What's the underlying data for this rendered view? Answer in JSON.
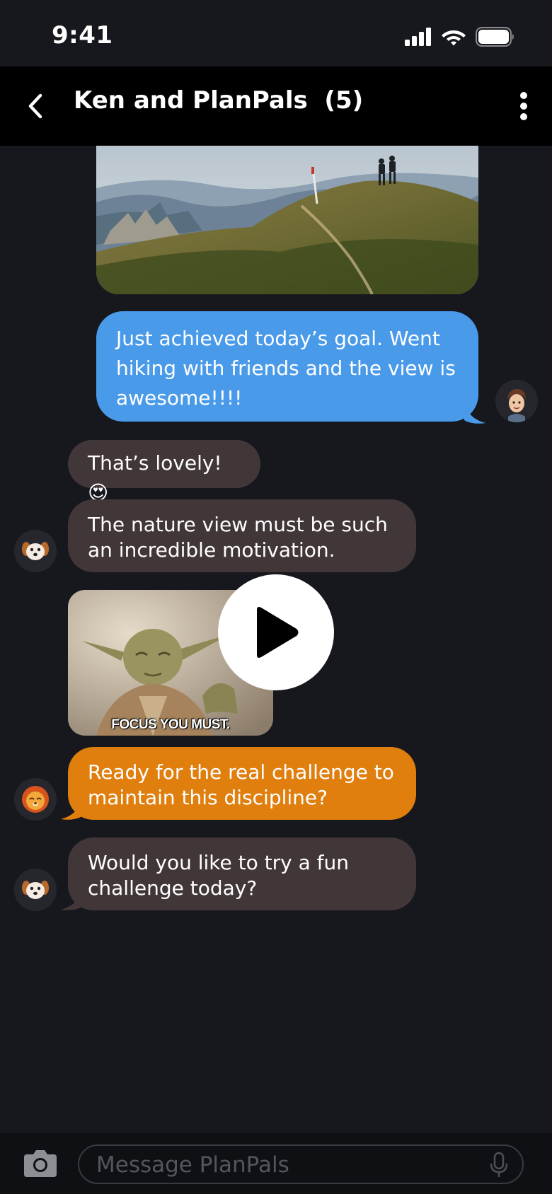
{
  "status_bar": {
    "time": "9:41",
    "icons": [
      "signal-icon",
      "wifi-icon",
      "battery-icon"
    ]
  },
  "header": {
    "back_icon": "chevron-left-icon",
    "title": "Ken and PlanPals  (5)",
    "more_icon": "more-vertical-icon"
  },
  "messages": [
    {
      "type": "image",
      "sender": "me",
      "description_icon": "photo"
    },
    {
      "type": "text",
      "sender": "me",
      "text": "Just achieved today’s goal. Went hiking with friends and the view is awesome!!!!"
    },
    {
      "type": "text",
      "sender": "puppy",
      "text": "That’s lovely! 😍"
    },
    {
      "type": "text",
      "sender": "puppy",
      "text": "The nature view must be such an incredible motivation."
    },
    {
      "type": "video",
      "sender": "puppy",
      "caption": "FOCUS YOU MUST."
    },
    {
      "type": "text",
      "sender": "lion",
      "text": "Ready for the real challenge to maintain this discipline?"
    },
    {
      "type": "text",
      "sender": "puppy",
      "text": "Would you like to try a fun challenge today?"
    }
  ],
  "composer": {
    "camera_icon": "camera-icon",
    "placeholder": "Message PlanPals",
    "mic_icon": "microphone-icon"
  },
  "colors": {
    "background": "#17181d",
    "header": "#000000",
    "my_bubble": "#4a9aea",
    "other_bubble": "#423738",
    "highlight_bubble": "#e07f0e"
  }
}
